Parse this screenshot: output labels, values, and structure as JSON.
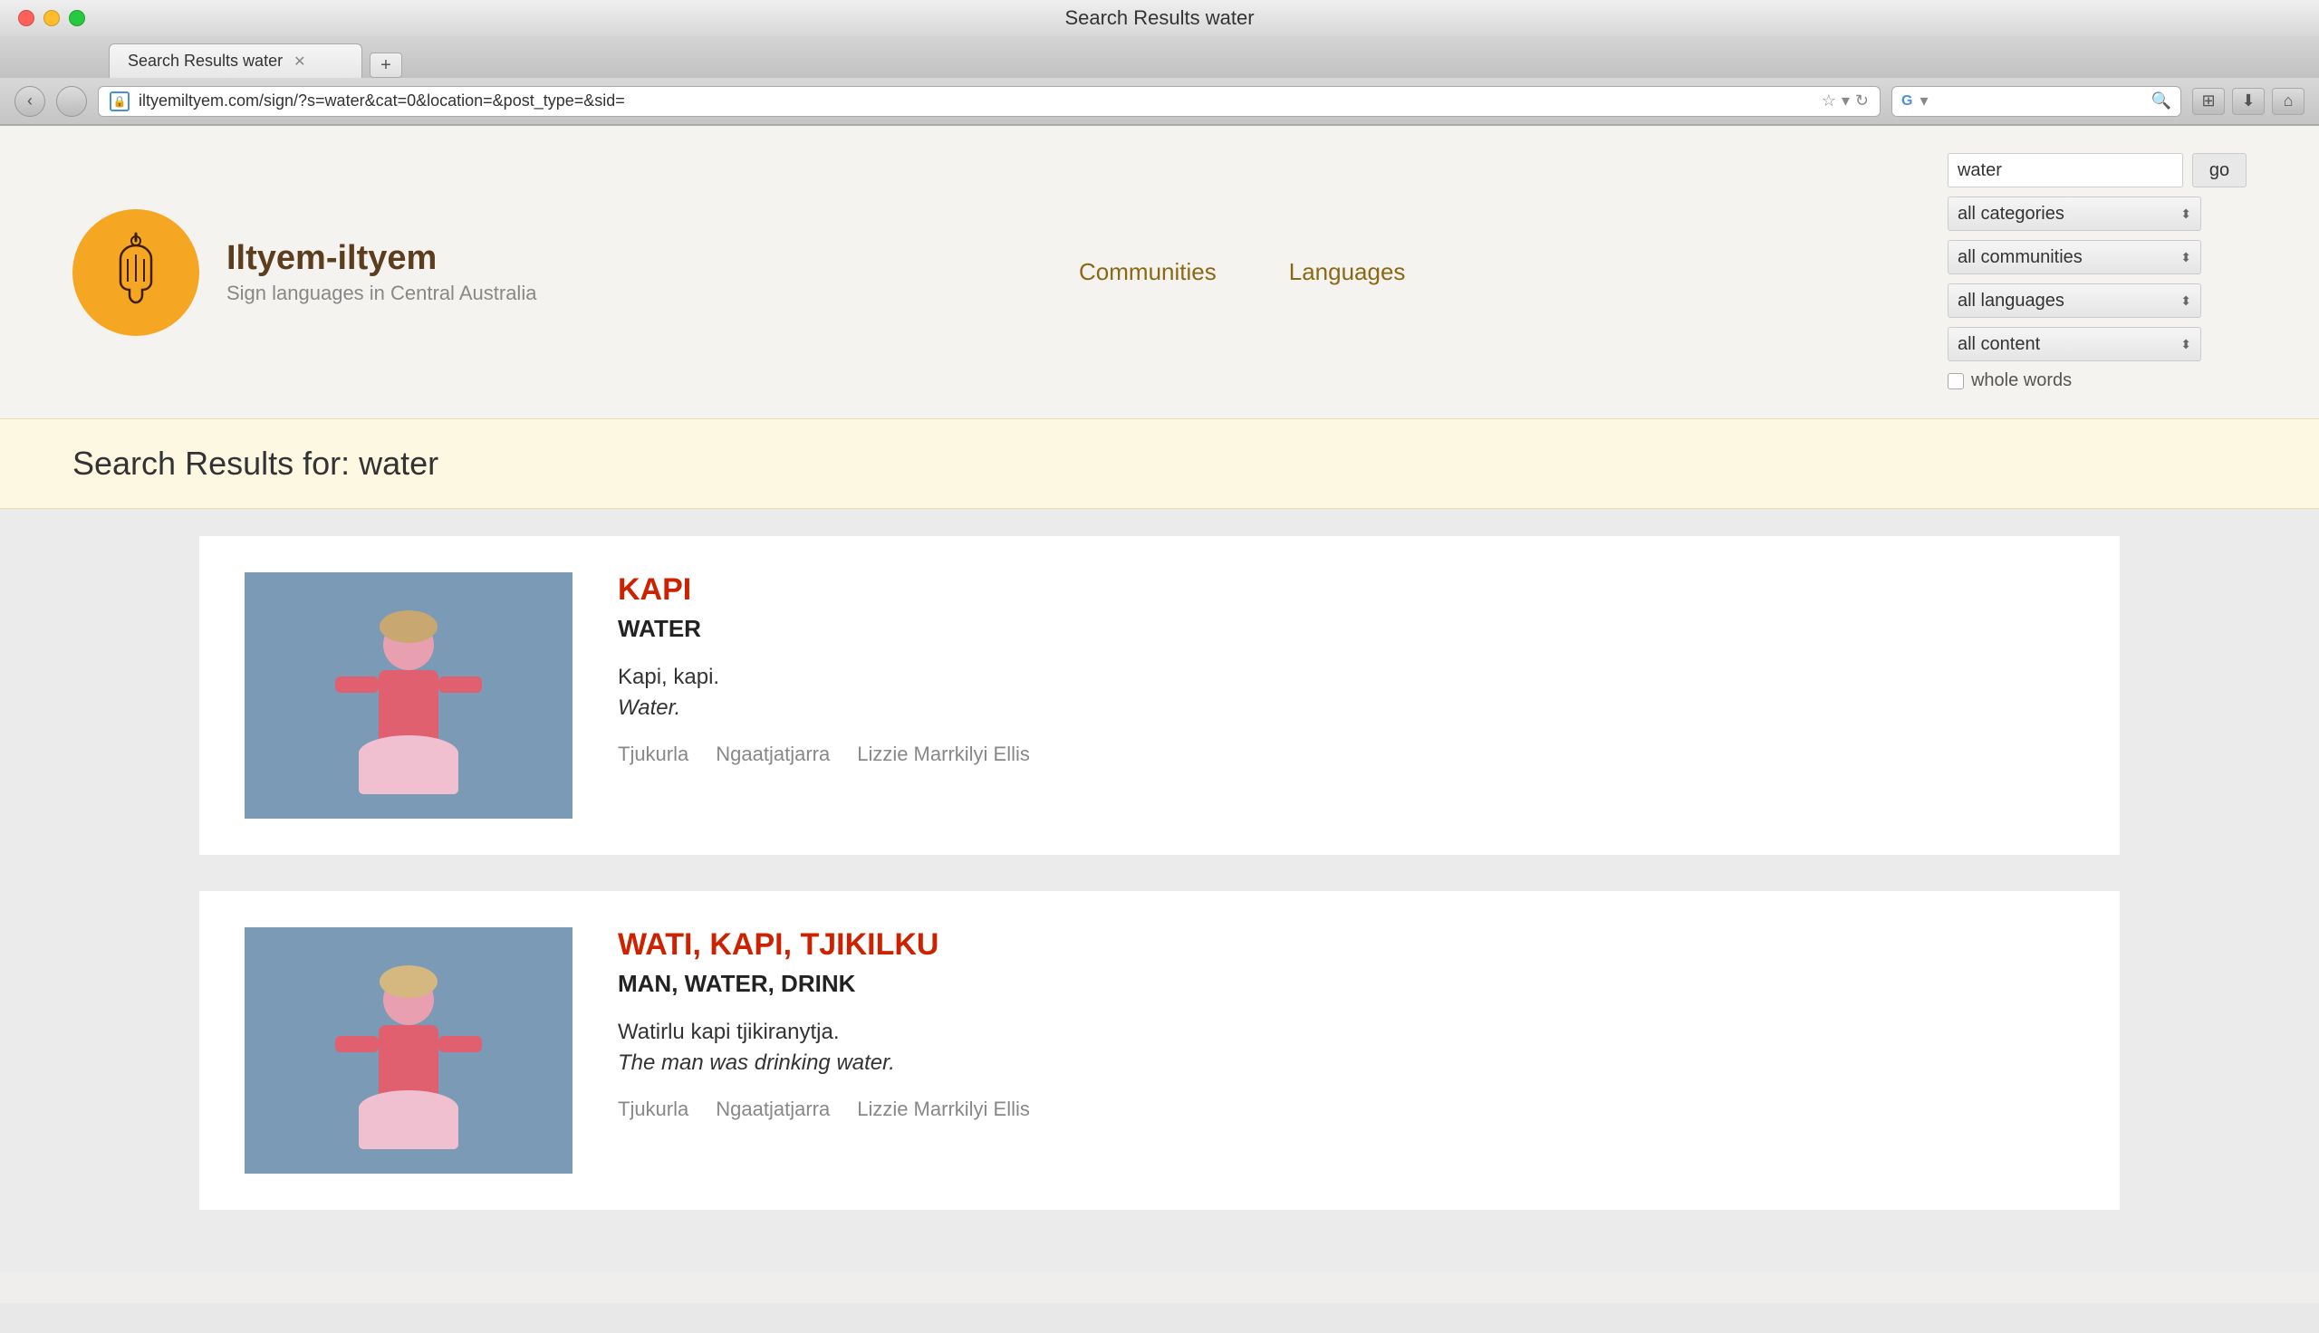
{
  "window": {
    "title": "Search Results water"
  },
  "tab": {
    "label": "Search Results water"
  },
  "address_bar": {
    "url": "iltyemiltyem.com/sign/?s=water&cat=0&location=&post_type=&sid=",
    "icon": "🔒"
  },
  "search_bar": {
    "engine": "Google",
    "placeholder": ""
  },
  "site": {
    "name": "Iltyem-iltyem",
    "tagline": "Sign languages in Central Australia",
    "nav": [
      {
        "label": "Communities"
      },
      {
        "label": "Languages"
      }
    ]
  },
  "search": {
    "query": "water",
    "go_button": "go",
    "filters": {
      "categories": "all categories",
      "communities": "all communities",
      "languages": "all languages",
      "content": "all content"
    },
    "whole_words_label": "whole words"
  },
  "results": {
    "heading": "Search Results for: water",
    "items": [
      {
        "id": 1,
        "title": "KAPI",
        "english": "WATER",
        "native_sentence": "Kapi, kapi.",
        "translation": "Water.",
        "meta": [
          "Tjukurla",
          "Ngaatjatjarra",
          "Lizzie Marrkilyi Ellis"
        ]
      },
      {
        "id": 2,
        "title": "WATI, KAPI, TJIKILKU",
        "english": "MAN, WATER, DRINK",
        "native_sentence": "Watirlu kapi tjikiranytja.",
        "translation": "The man was drinking water.",
        "meta": [
          "Tjukurla",
          "Ngaatjatjarra",
          "Lizzie Marrkilyi Ellis"
        ]
      }
    ]
  }
}
